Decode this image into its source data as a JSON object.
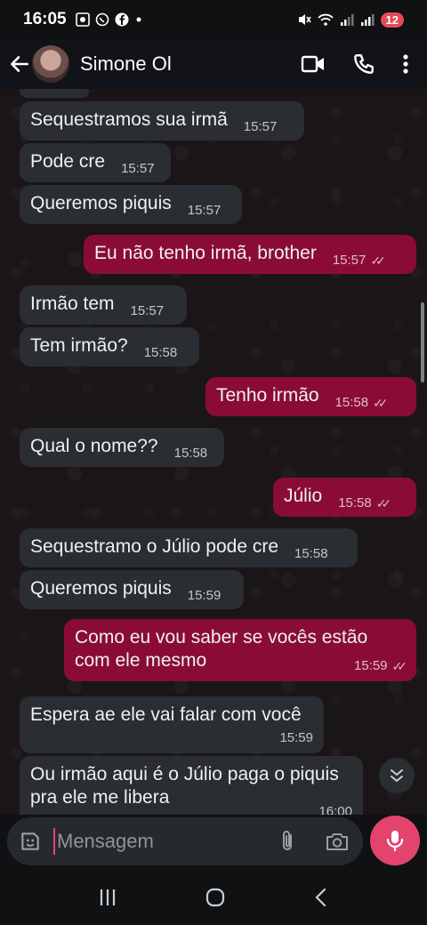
{
  "status": {
    "time": "16:05",
    "battery": "12"
  },
  "header": {
    "contact_name": "Simone Ol"
  },
  "messages": [
    {
      "dir": "in",
      "text": "Sequestramos sua irmã",
      "time": "15:57"
    },
    {
      "dir": "in",
      "text": "Pode cre",
      "time": "15:57"
    },
    {
      "dir": "in",
      "text": "Queremos piquis",
      "time": "15:57"
    },
    {
      "dir": "out",
      "text": "Eu não tenho irmã, brother",
      "time": "15:57"
    },
    {
      "dir": "in",
      "text": "Irmão tem",
      "time": "15:57"
    },
    {
      "dir": "in",
      "text": "Tem irmão?",
      "time": "15:58"
    },
    {
      "dir": "out",
      "text": "Tenho irmão",
      "time": "15:58"
    },
    {
      "dir": "in",
      "text": "Qual o nome??",
      "time": "15:58"
    },
    {
      "dir": "out",
      "text": "Júlio",
      "time": "15:58"
    },
    {
      "dir": "in",
      "text": "Sequestramo o Júlio pode cre",
      "time": "15:58"
    },
    {
      "dir": "in",
      "text": "Queremos piquis",
      "time": "15:59"
    },
    {
      "dir": "out",
      "text": "Como eu vou saber se vocês estão com ele mesmo",
      "time": "15:59"
    },
    {
      "dir": "in",
      "text": "Espera ae ele vai falar com você",
      "time": "15:59"
    },
    {
      "dir": "in",
      "text": "Ou irmão aqui é o Júlio paga o piquis pra ele me libera",
      "time": "16:00"
    }
  ],
  "composer": {
    "placeholder": "Mensagem"
  },
  "colors": {
    "incoming": "#2a2d31",
    "outgoing": "#8a0c36",
    "accent": "#e2446e"
  },
  "icons": [
    "back-arrow-icon",
    "video-call-icon",
    "phone-icon",
    "more-options-icon",
    "sticker-icon",
    "attach-icon",
    "camera-icon",
    "mic-icon",
    "double-chevron-down-icon"
  ]
}
